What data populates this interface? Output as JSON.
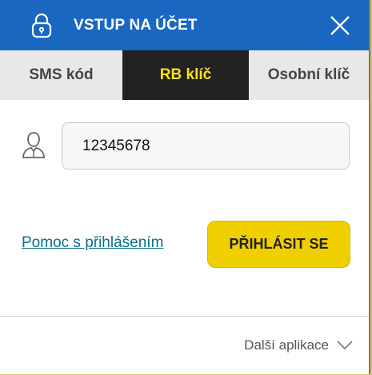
{
  "header": {
    "title": "VSTUP NA ÚČET",
    "icons": {
      "left": "lock-icon",
      "right": "close-icon"
    }
  },
  "tabs": [
    {
      "label": "SMS kód",
      "active": false
    },
    {
      "label": "RB klíč",
      "active": true
    },
    {
      "label": "Osobní klíč",
      "active": false
    }
  ],
  "form": {
    "username_value": "12345678",
    "user_icon": "user-icon"
  },
  "actions": {
    "help_link": "Pomoc s přihlášením",
    "login_button": "PŘIHLÁSIT SE"
  },
  "footer": {
    "more_apps_label": "Další aplikace",
    "chevron_icon": "chevron-down-icon"
  },
  "colors": {
    "header_bg": "#1a67c2",
    "active_tab_bg": "#222222",
    "active_tab_text": "#f7e11f",
    "button_bg": "#f0cf00",
    "link": "#0b6f86"
  }
}
